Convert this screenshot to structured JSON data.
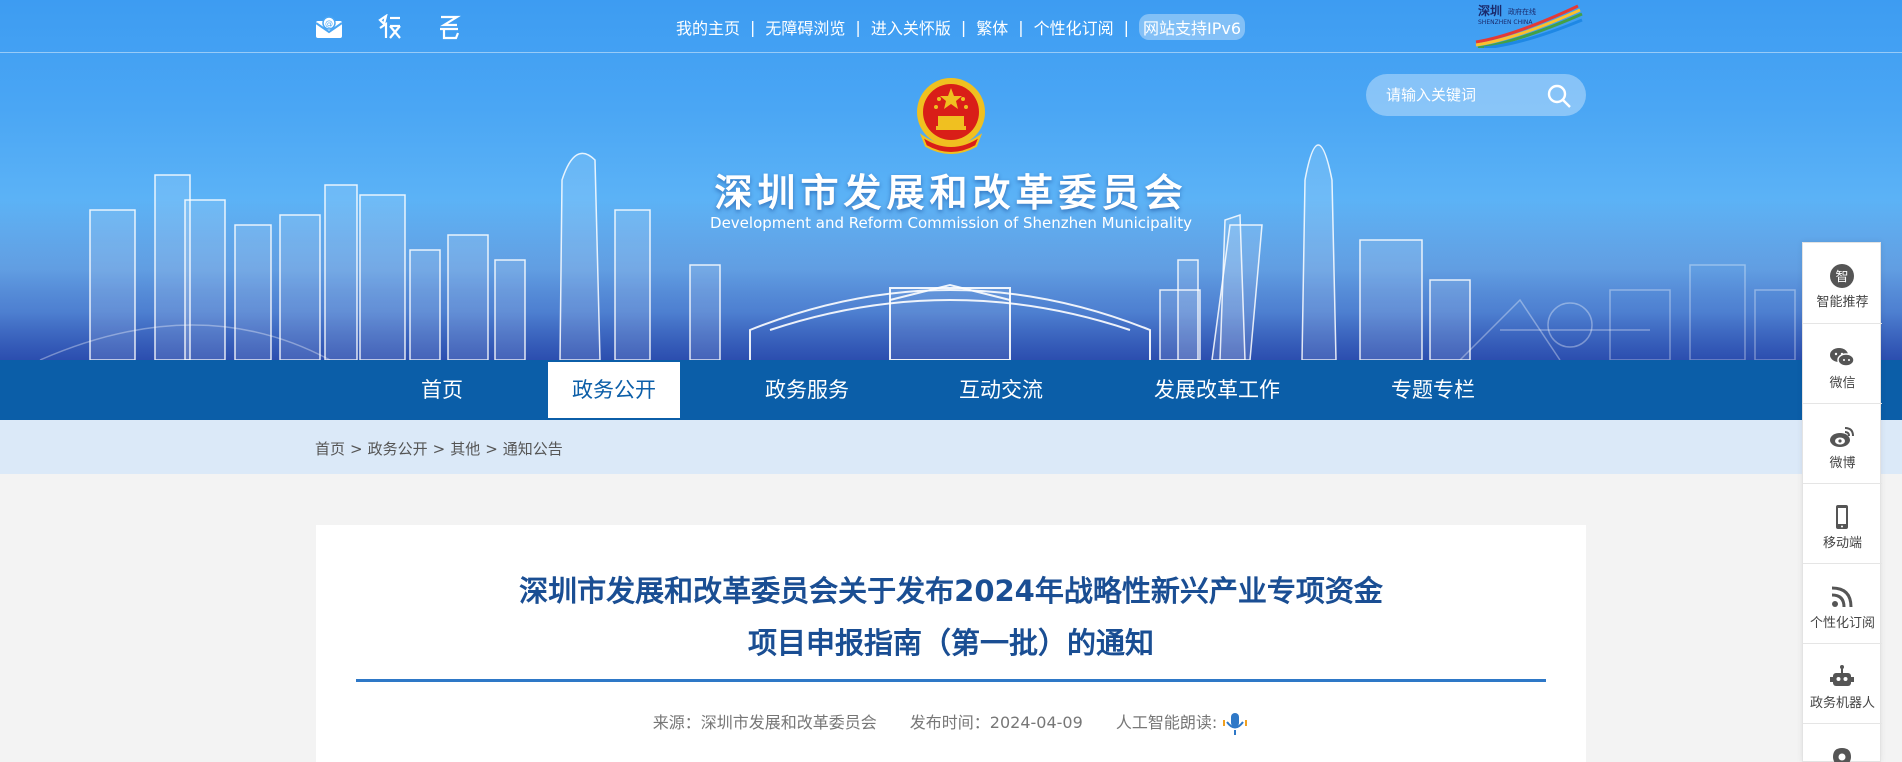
{
  "top_links": [
    "我的主页",
    "无障碍浏览",
    "进入关怀版",
    "繁体",
    "个性化订阅",
    "网站支持IPv6"
  ],
  "top_icons": [
    "email-icon",
    "ai-assistant-icon",
    "elder-care-icon"
  ],
  "shenzhen_logo": {
    "text_cn": "深圳",
    "text_sub": "政府在线",
    "text_en": "SHENZHEN CHINA"
  },
  "search": {
    "placeholder": "请输入关键词"
  },
  "site": {
    "title": "深圳市发展和改革委员会",
    "subtitle": "Development and Reform Commission of Shenzhen Municipality"
  },
  "nav": {
    "items": [
      "首页",
      "政务公开",
      "政务服务",
      "互动交流",
      "发展改革工作",
      "专题专栏"
    ],
    "active": "政务公开"
  },
  "breadcrumb": [
    "首页",
    "政务公开",
    "其他",
    "通知公告"
  ],
  "breadcrumb_sep": ">",
  "article": {
    "title_line1": "深圳市发展和改革委员会关于发布2024年战略性新兴产业专项资金",
    "title_line2": "项目申报指南（第一批）的通知",
    "source": "来源：深圳市发展和改革委员会",
    "publish_time": "发布时间：2024-04-09",
    "ai_read": "人工智能朗读:"
  },
  "side_tools": [
    {
      "label": "智能推荐",
      "icon": "smart-recommend-icon",
      "glyph": "智"
    },
    {
      "label": "微信",
      "icon": "wechat-icon"
    },
    {
      "label": "微博",
      "icon": "weibo-icon"
    },
    {
      "label": "移动端",
      "icon": "mobile-icon"
    },
    {
      "label": "个性化订阅",
      "icon": "rss-icon"
    },
    {
      "label": "政务机器人",
      "icon": "robot-icon"
    },
    {
      "label": "",
      "icon": "location-icon"
    }
  ],
  "colors": {
    "nav_bg": "#0b5ea8",
    "title_blue": "#1a4e93",
    "rule_blue": "#2e78c7",
    "crumb_bg": "#dbe9f8",
    "banner_blue": "#4aa6f4"
  }
}
